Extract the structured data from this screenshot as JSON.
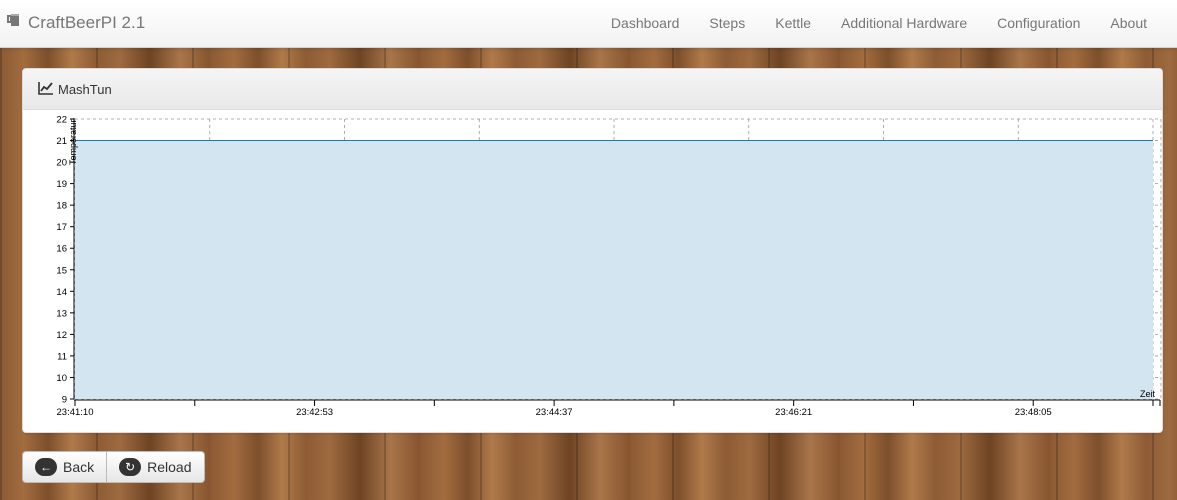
{
  "navbar": {
    "brand": "CraftBeerPI 2.1",
    "brand_icon": "beer-mug-icon",
    "items": [
      {
        "label": "Dashboard"
      },
      {
        "label": "Steps"
      },
      {
        "label": "Kettle"
      },
      {
        "label": "Additional Hardware"
      },
      {
        "label": "Configuration"
      },
      {
        "label": "About"
      }
    ]
  },
  "panel": {
    "title": "MashTun",
    "title_icon": "line-chart-icon"
  },
  "buttons": {
    "back": {
      "label": "Back",
      "icon": "circle-arrow-left-icon"
    },
    "reload": {
      "label": "Reload",
      "icon": "refresh-icon"
    }
  },
  "colors": {
    "series_line": "#1f77b4",
    "series_fill": "#d4e5f2",
    "grid": "#999999"
  },
  "chart_data": {
    "type": "area",
    "xlabel": "Zeit",
    "ylabel": "Temperatur",
    "ylim": [
      9,
      22
    ],
    "yticks": [
      9,
      10,
      11,
      12,
      13,
      14,
      15,
      16,
      17,
      18,
      19,
      20,
      21,
      22
    ],
    "xtick_labels": [
      "23:41:10",
      "23:42:53",
      "23:44:37",
      "23:46:21",
      "23:48:05"
    ],
    "x": [
      "23:41:10",
      "23:49:47"
    ],
    "series": [
      {
        "values": [
          21,
          21
        ]
      }
    ],
    "grid": true
  }
}
